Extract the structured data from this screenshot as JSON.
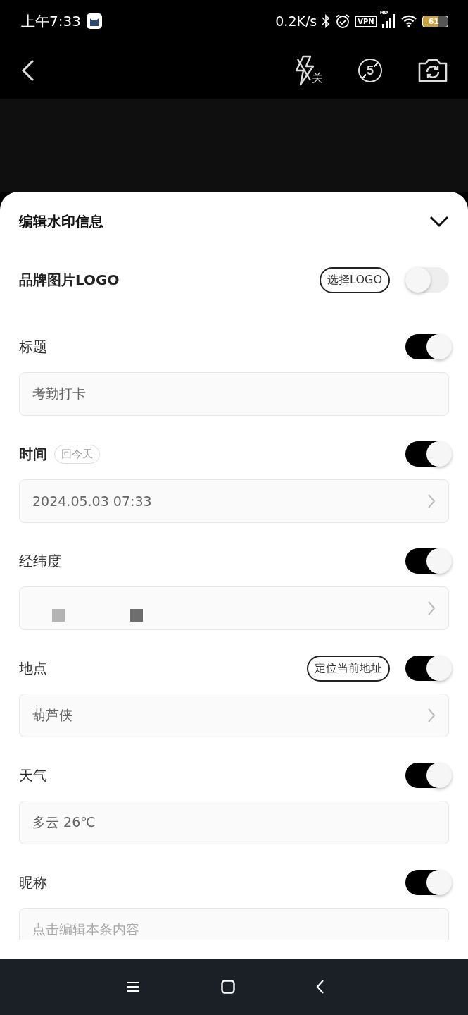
{
  "status_bar": {
    "time": "上午7:33",
    "speed": "0.2K/s",
    "vpn": "VPN",
    "network": "HD",
    "battery": "61"
  },
  "toolbar": {
    "flash_label": "关",
    "timer_label": "5"
  },
  "sheet": {
    "title": "编辑水印信息",
    "logo": {
      "label": "品牌图片LOGO",
      "button": "选择LOGO",
      "on": false
    },
    "sections": [
      {
        "label": "标题",
        "bold": false,
        "on": true,
        "field": {
          "value": "考勤打卡",
          "chevron": false
        }
      },
      {
        "label": "时间",
        "bold": true,
        "tag": "回今天",
        "on": true,
        "field": {
          "value": "2024.05.03 07:33",
          "chevron": true
        }
      },
      {
        "label": "经纬度",
        "bold": false,
        "on": true,
        "field": {
          "redacted": true,
          "chevron": true
        }
      },
      {
        "label": "地点",
        "bold": false,
        "button": "定位当前地址",
        "on": true,
        "field": {
          "value": "葫芦侠",
          "chevron": true
        }
      },
      {
        "label": "天气",
        "bold": false,
        "on": true,
        "field": {
          "value": "多云 26℃",
          "chevron": false
        }
      },
      {
        "label": "昵称",
        "bold": false,
        "on": true,
        "field": {
          "placeholder": "点击编辑本条内容",
          "chevron": false
        }
      }
    ]
  }
}
